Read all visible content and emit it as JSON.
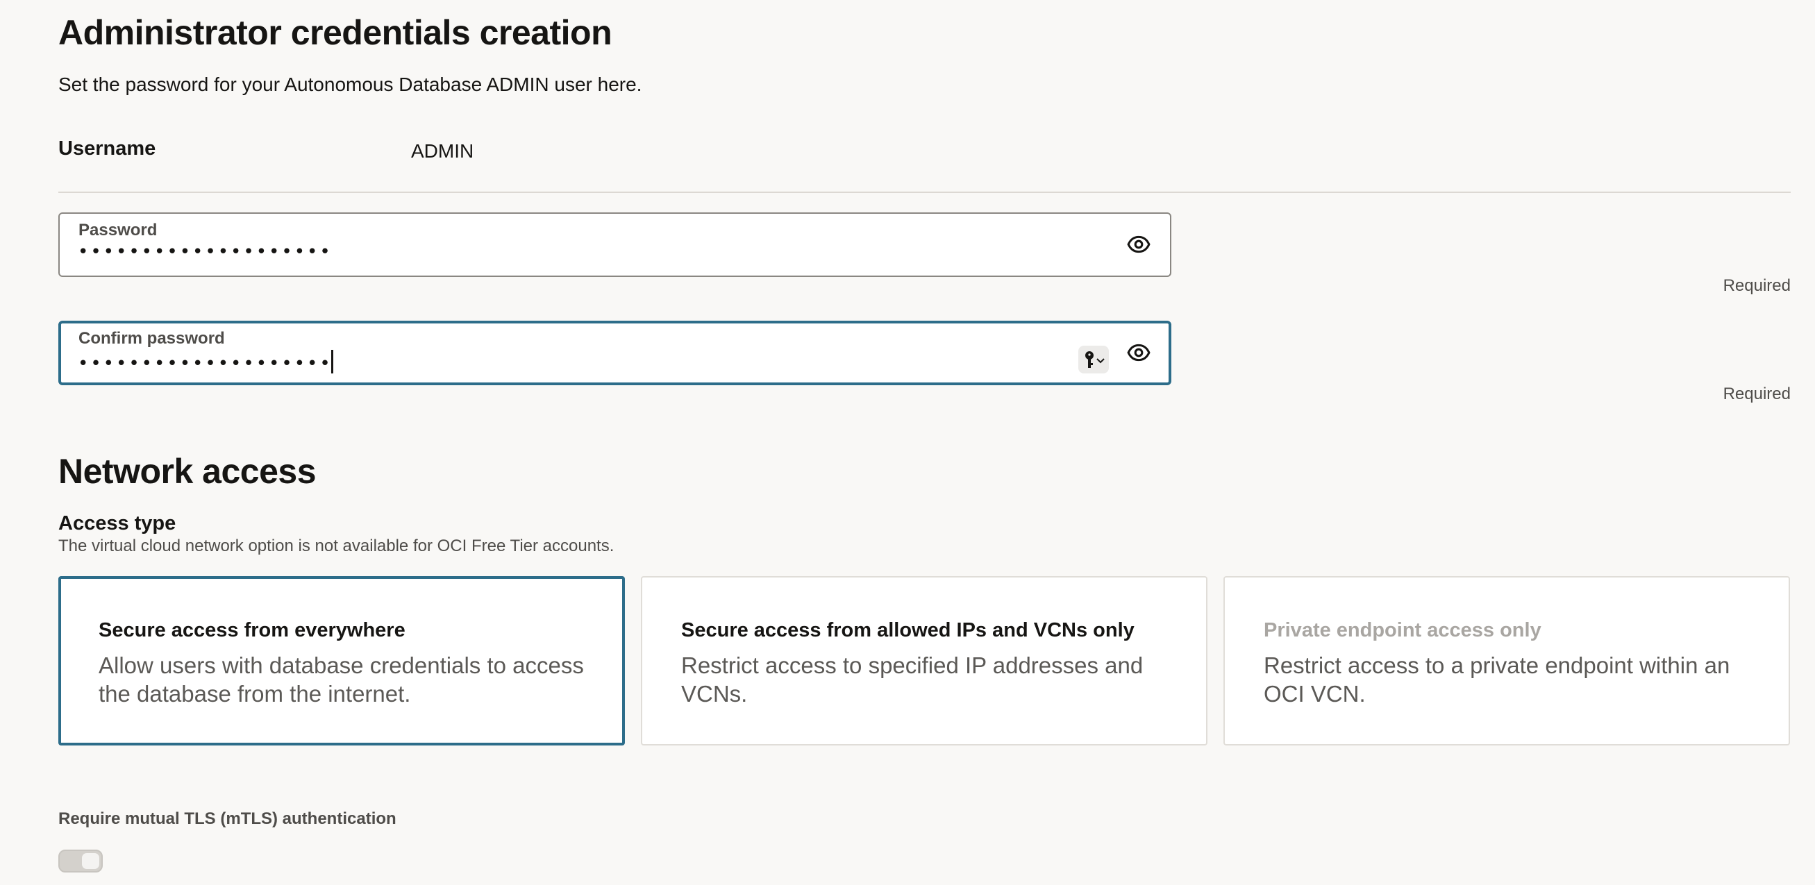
{
  "credentials": {
    "title": "Administrator credentials creation",
    "intro": "Set the password for your Autonomous Database ADMIN user here.",
    "username_label": "Username",
    "username_value": "ADMIN",
    "password": {
      "label": "Password",
      "value": "••••••••••••••••••••",
      "helper": "Required"
    },
    "confirm_password": {
      "label": "Confirm password",
      "value": "••••••••••••••••••••",
      "helper": "Required"
    }
  },
  "network": {
    "title": "Network access",
    "access_type_label": "Access type",
    "access_type_hint": "The virtual cloud network option is not available for OCI Free Tier accounts.",
    "options": [
      {
        "title": "Secure access from everywhere",
        "description": "Allow users with database credentials to access the database from the internet.",
        "selected": true,
        "disabled": false
      },
      {
        "title": "Secure access from allowed IPs and VCNs only",
        "description": "Restrict access to specified IP addresses and VCNs.",
        "selected": false,
        "disabled": false
      },
      {
        "title": "Private endpoint access only",
        "description": "Restrict access to a private endpoint within an OCI VCN.",
        "selected": false,
        "disabled": true
      }
    ],
    "mtls_label": "Require mutual TLS (mTLS) authentication",
    "mtls_enabled": false
  },
  "colors": {
    "accent": "#2d6d8a",
    "background": "#f9f8f6",
    "text": "#161513",
    "muted_text": "#4e4c49",
    "disabled_text": "#a9a6a2"
  },
  "icons": {
    "password_visibility": "eye-icon",
    "password_manager": "key-icon",
    "dropdown": "chevron-down-icon"
  }
}
